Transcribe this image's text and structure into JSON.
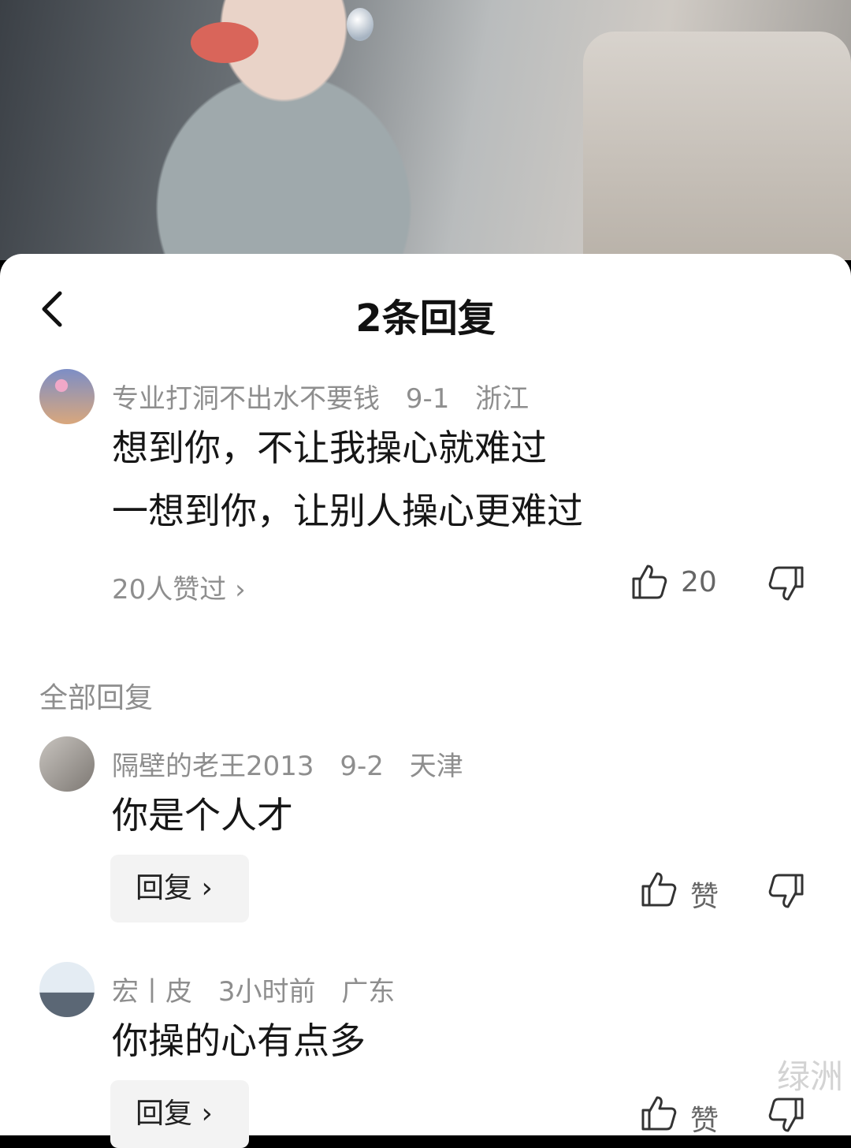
{
  "header": {
    "back_icon": "chevron-left-icon",
    "title": "2条回复"
  },
  "root_comment": {
    "username": "专业打洞不出水不要钱",
    "date": "9-1",
    "location": "浙江",
    "lines": [
      "想到你，不让我操心就难过",
      "一想到你，让别人操心更难过"
    ],
    "liked_by": "20人赞过 ›",
    "like_count": "20"
  },
  "section_label": "全部回复",
  "replies": [
    {
      "username": "隔壁的老王2013",
      "date": "9-2",
      "location": "天津",
      "text": "你是个人才",
      "reply_label": "回复 ›",
      "like_label": "赞"
    },
    {
      "username": "宏丨皮",
      "date": "3小时前",
      "location": "广东",
      "text": "你操的心有点多",
      "reply_label": "回复 ›",
      "like_label": "赞"
    }
  ],
  "watermark": "绿洲"
}
